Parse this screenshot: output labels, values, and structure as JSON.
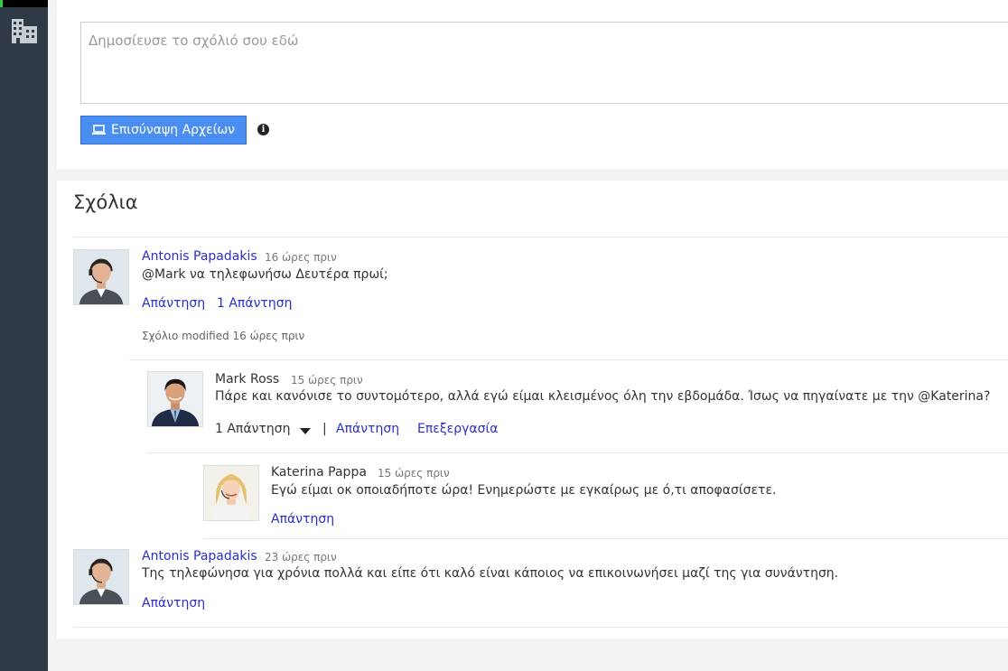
{
  "compose": {
    "placeholder": "Δημοσίευσε το σχόλιό σου εδώ",
    "attach_label": "Επισύναψη Αρχείων",
    "info_glyph": "i"
  },
  "comments_title": "Σχόλια",
  "comments": [
    {
      "author": "Antonis Papadakis",
      "time": "16 ώρες πριν",
      "text": "@Mark να τηλεφωνήσω Δευτέρα πρωί;",
      "reply_label": "Απάντηση",
      "replies_count_label": "1 Απάντηση",
      "modified_label": "Σχόλιο modified 16 ώρες πριν"
    },
    {
      "author": "Mark Ross",
      "time": "15 ώρες πριν",
      "text": "Πάρε και κανόνισε το συντομότερο, αλλά εγώ είμαι κλεισμένος όλη την εβδομάδα. Ίσως να πηγαίνατε με την @Katerina?",
      "replies_count_label": "1 Απάντηση",
      "separator": "|",
      "reply_label": "Απάντηση",
      "edit_label": "Επεξεργασία"
    },
    {
      "author": "Katerina Pappa",
      "time": "15 ώρες πριν",
      "text": "Εγώ είμαι οκ οποιαδήποτε ώρα! Ενημερώστε με εγκαίρως με ό,τι αποφασίσετε.",
      "reply_label": "Απάντηση"
    },
    {
      "author": "Antonis Papadakis",
      "time": "23 ώρες πριν",
      "text": "Της τηλεφώνησα για χρόνια πολλά και είπε ότι καλό είναι κάποιος να επικοινωνήσει μαζί της για συνάντηση.",
      "reply_label": "Απάντηση"
    }
  ],
  "colors": {
    "sidebar": "#2f3a46",
    "accent": "#2ecc40",
    "button": "#4a8ef2",
    "link": "#2a2fc7"
  }
}
